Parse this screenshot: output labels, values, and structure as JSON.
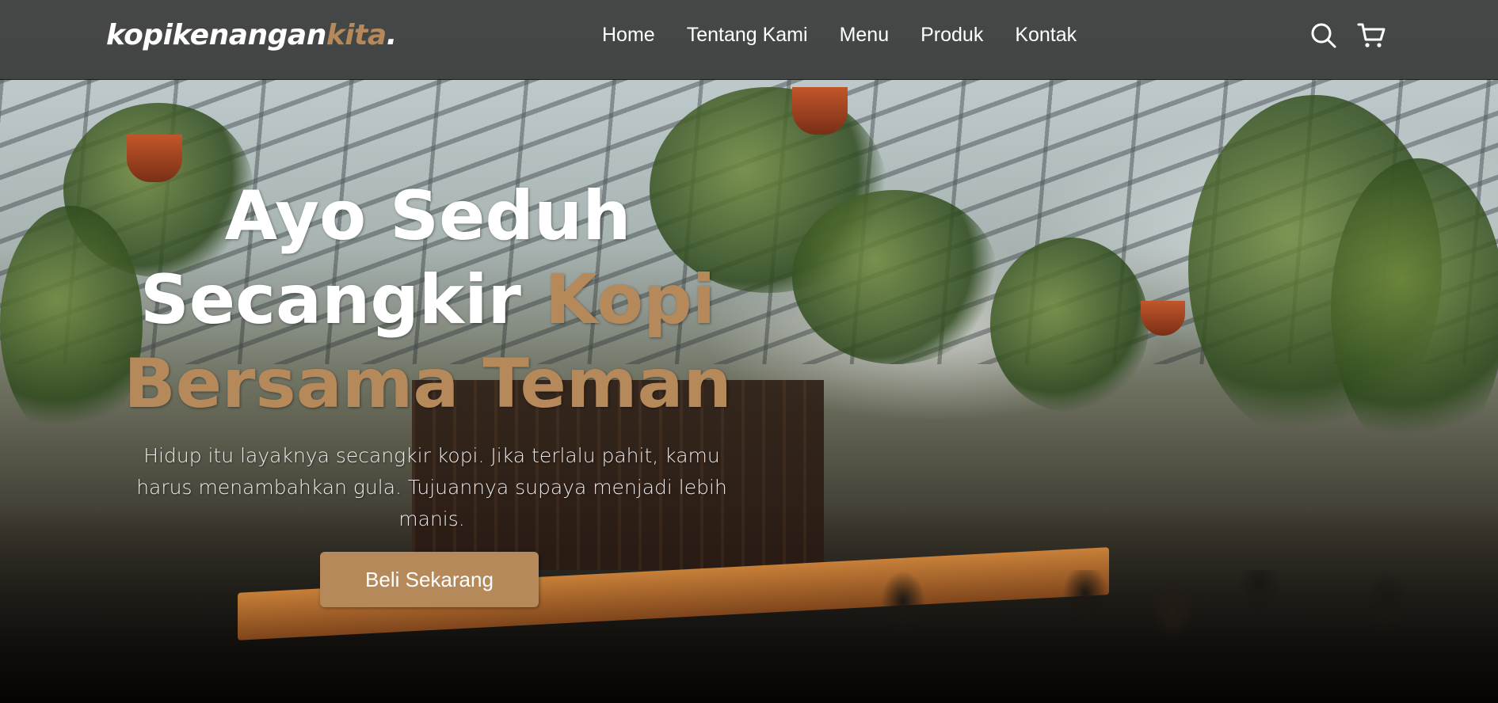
{
  "navbar": {
    "logo_main": "kopikenangan",
    "logo_accent": "kita",
    "logo_dot": ".",
    "links": [
      "Home",
      "Tentang Kami",
      "Menu",
      "Produk",
      "Kontak"
    ],
    "icons": [
      "search-icon",
      "shopping-cart-icon"
    ]
  },
  "hero": {
    "headline_part1": "Ayo Seduh Secangkir ",
    "headline_accent": "Kopi Bersama Teman",
    "subtext": "Hidup itu layaknya secangkir kopi. Jika terlalu pahit, kamu harus menambahkan gula. Tujuannya supaya menjadi lebih manis.",
    "cta_label": "Beli Sekarang"
  },
  "colors": {
    "accent": "#b6895b",
    "navbar_bg": "rgba(20,18,16,0.72)",
    "text": "#ffffff"
  }
}
